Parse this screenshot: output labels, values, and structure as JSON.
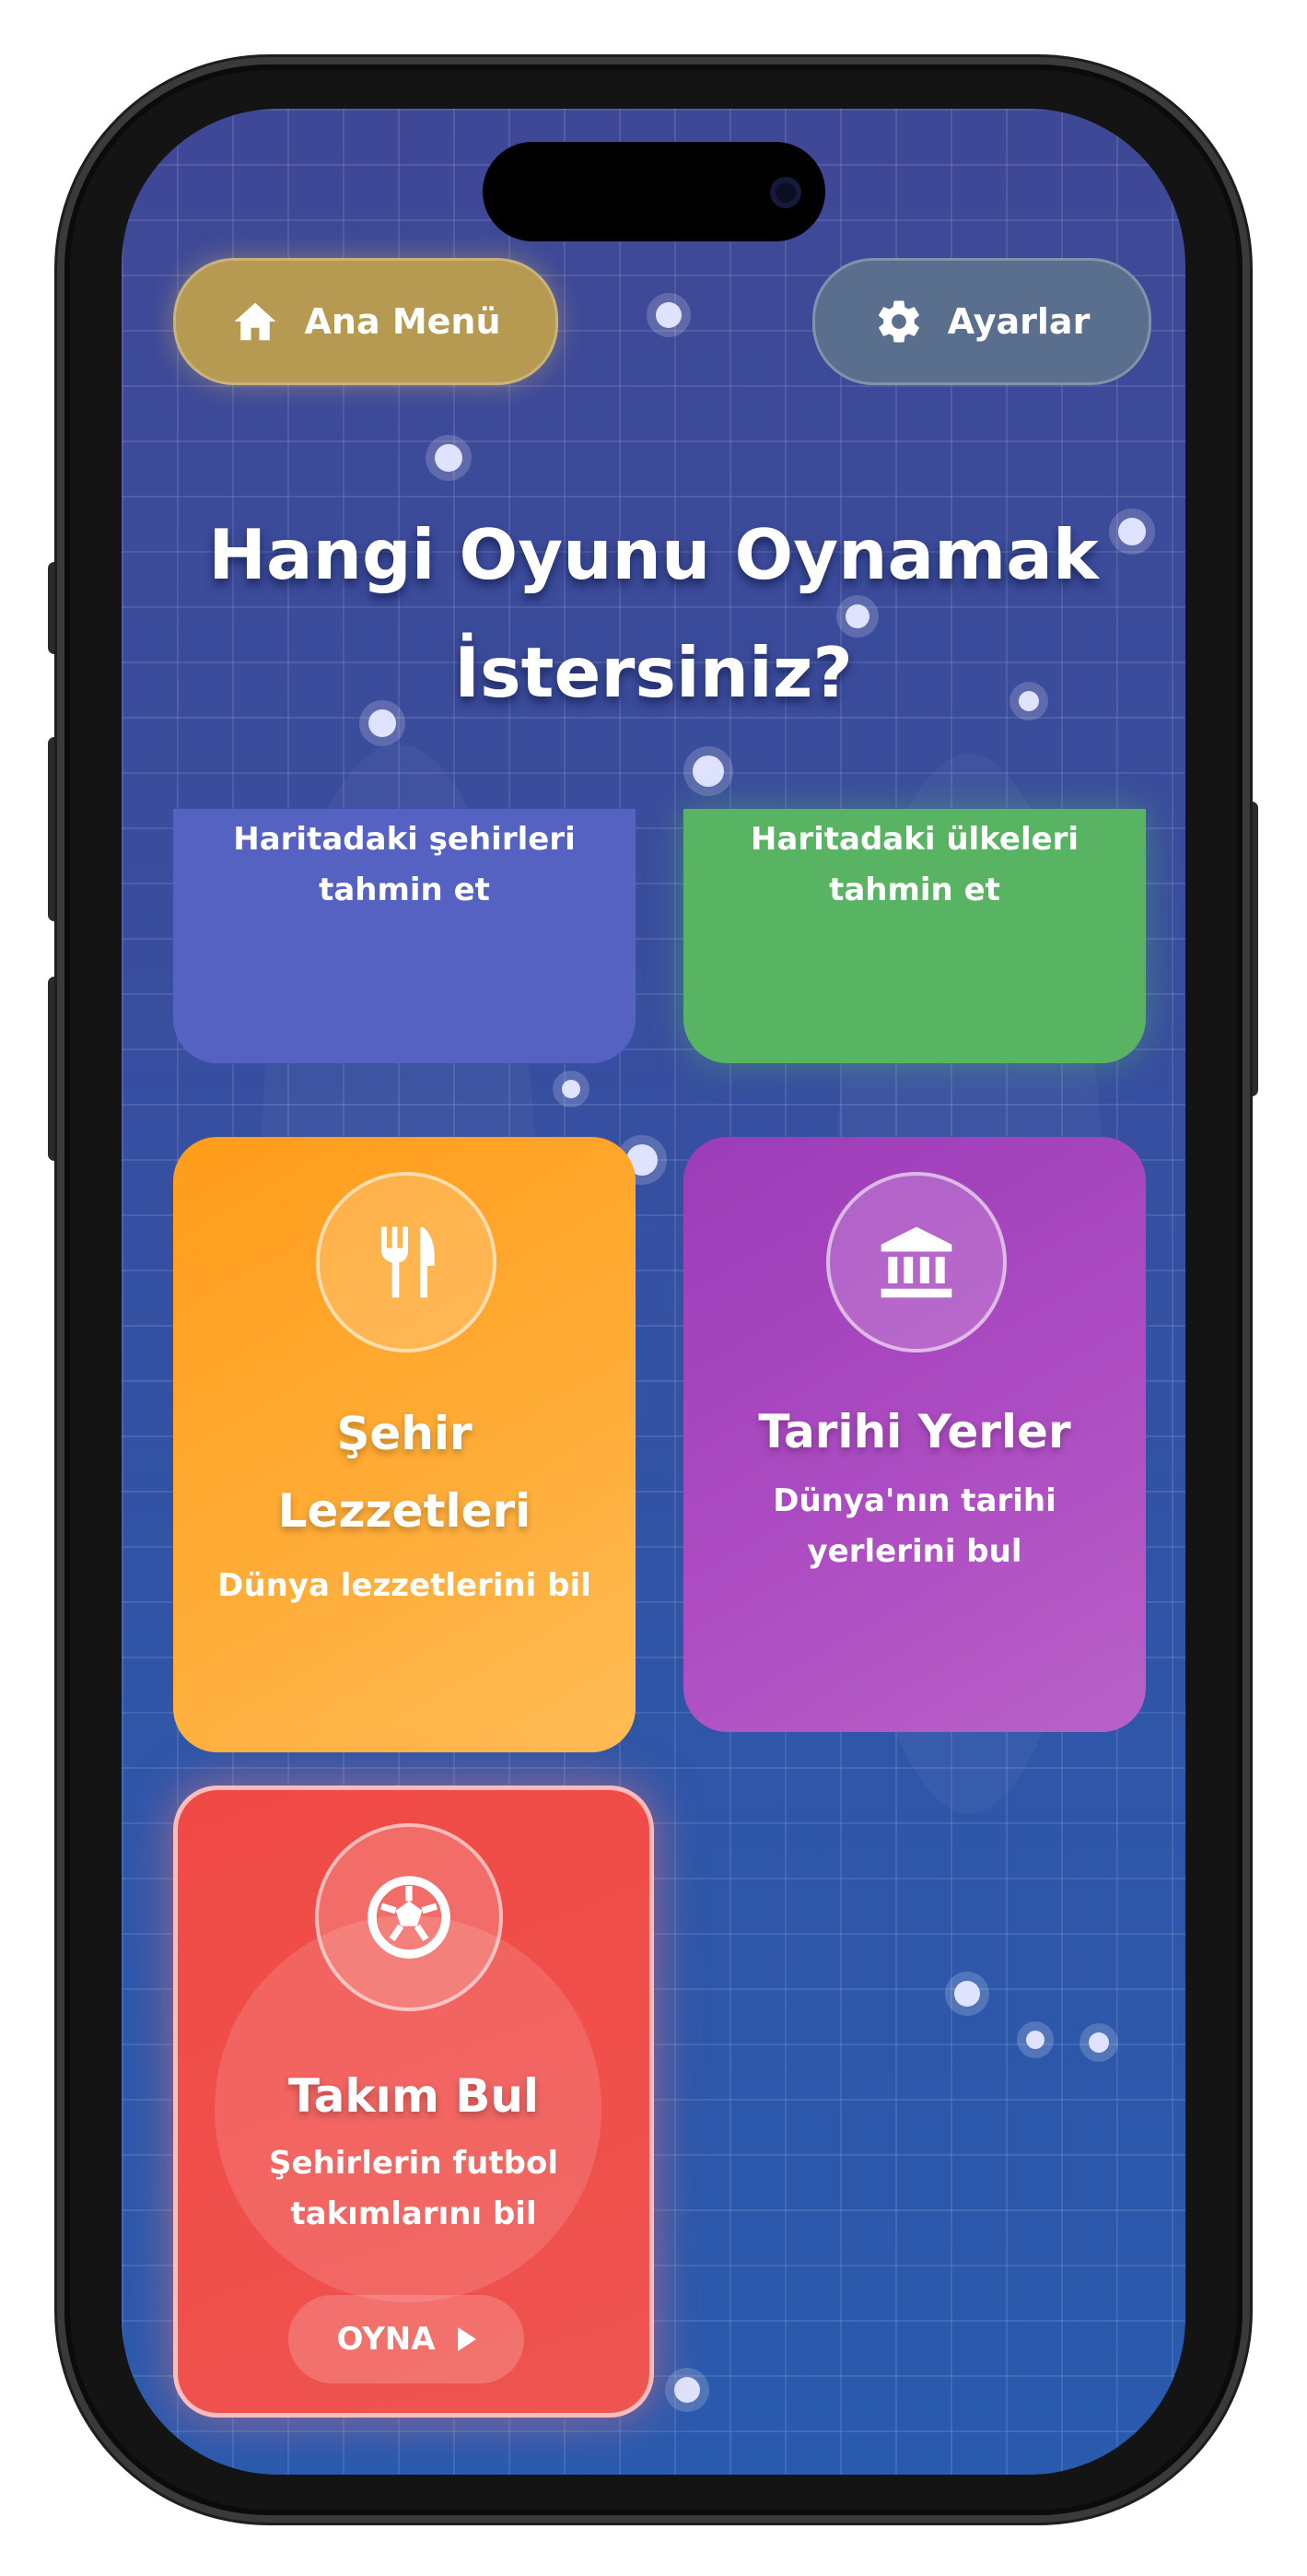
{
  "header": {
    "home_label": "Ana Menü",
    "home_icon": "home-icon",
    "settings_label": "Ayarlar",
    "settings_icon": "gear-icon"
  },
  "title": {
    "line1": "Hangi Oyunu Oynamak",
    "line2": "İstersiniz?"
  },
  "cards": [
    {
      "name": "",
      "description_line1": "Haritadaki şehirleri",
      "description_line2": "tahmin et",
      "color": "#5562c2"
    },
    {
      "name": "",
      "description_line1": "Haritadaki ülkeleri",
      "description_line2": "tahmin et",
      "color": "#58b463"
    },
    {
      "name_line1": "Şehir",
      "name_line2": "Lezzetleri",
      "description": "Dünya lezzetlerini bil",
      "icon": "utensils-icon",
      "color": "#ffa62b"
    },
    {
      "name": "Tarihi Yerler",
      "description_line1": "Dünya'nın tarihi",
      "description_line2": "yerlerini bul",
      "icon": "landmark-icon",
      "color": "#a845bd"
    },
    {
      "name": "Takım Bul",
      "description_line1": "Şehirlerin futbol",
      "description_line2": "takımlarını bil",
      "icon": "soccer-ball-icon",
      "button_label": "OYNA",
      "color": "#f04a45"
    }
  ]
}
